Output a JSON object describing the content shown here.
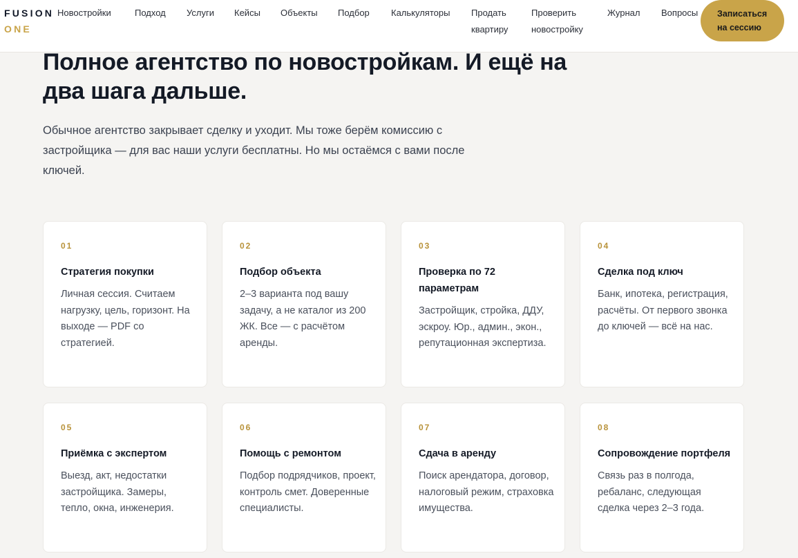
{
  "header": {
    "logo_top": "FUSION",
    "logo_bottom": "ONE",
    "nav": [
      "Новостройки",
      "Подход",
      "Услуги",
      "Кейсы",
      "Объекты",
      "Подбор",
      "Калькуляторы",
      "Продать квартиру",
      "Проверить новостройку",
      "Журнал",
      "Вопросы"
    ],
    "cta_label": "Записаться на сессию"
  },
  "hero": {
    "title": "Полное агентство по новостройкам. И ещё на два шага дальше.",
    "lead": "Обычное агентство закрывает сделку и уходит. Мы тоже берём комиссию с застройщика — для вас наши услуги бесплатны. Но мы остаёмся с вами после ключей."
  },
  "services": [
    {
      "num": "01",
      "title": "Стратегия покупки",
      "text": "Личная сессия. Считаем нагрузку, цель, горизонт. На выходе — PDF со стратегией."
    },
    {
      "num": "02",
      "title": "Подбор объекта",
      "text": "2–3 варианта под вашу задачу, а не каталог из 200 ЖК. Все — с расчётом аренды."
    },
    {
      "num": "03",
      "title": "Проверка по 72 параметрам",
      "text": "Застройщик, стройка, ДДУ, эскроу. Юр., админ., экон., репутационная экспертиза."
    },
    {
      "num": "04",
      "title": "Сделка под ключ",
      "text": "Банк, ипотека, регистрация, расчёты. От первого звонка до ключей — всё на нас."
    },
    {
      "num": "05",
      "title": "Приёмка с экспертом",
      "text": "Выезд, акт, недостатки застройщика. Замеры, тепло, окна, инженерия."
    },
    {
      "num": "06",
      "title": "Помощь с ремонтом",
      "text": "Подбор подрядчиков, проект, контроль смет. Доверенные специалисты."
    },
    {
      "num": "07",
      "title": "Сдача в аренду",
      "text": "Поиск арендатора, договор, налоговый режим, страховка имущества."
    },
    {
      "num": "08",
      "title": "Сопровождение портфеля",
      "text": "Связь раз в полгода, ребаланс, следующая сделка через 2–3 года."
    }
  ],
  "colors": {
    "accent": "#c9a449",
    "page_bg": "#f5f4f2",
    "card_bg": "#ffffff",
    "heading": "#141a26"
  }
}
